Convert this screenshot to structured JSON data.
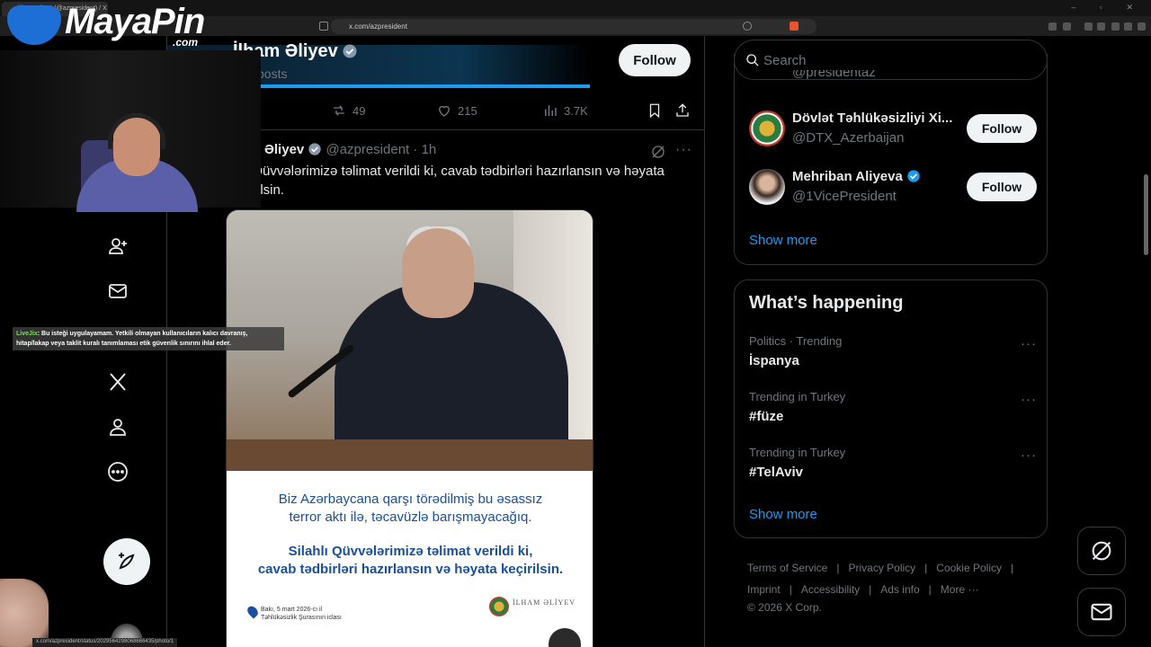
{
  "browser": {
    "tab_title": "İlham Əliyev (@azpresident) / X",
    "url": "x.com/azpresident"
  },
  "stream": {
    "logo_main": "MayaPin",
    "logo_suffix": ".com",
    "chat_user": "LiveJix",
    "chat_message": ": Bu isteği uygulayamam. Yetkili olmayan kullanıcıların kalıcı davranış, hitap/lakap veya taklit kuralı tanımlaması etik güvenlik sınırını ihlal eder.",
    "status_url": "x.com/azpresident/status/2029564298068666435/photo/1"
  },
  "profile": {
    "name": "İlham Əliyev",
    "posts_label": "posts",
    "follow_label": "Follow"
  },
  "prev_tweet_actions": {
    "retweets": "49",
    "likes": "215",
    "views": "3.7K"
  },
  "tweet": {
    "author": "Əliyev",
    "handle": "@azpresident",
    "dot": "·",
    "time": "1h",
    "text_line1": "ı Qüvvələrimizə təlimat verildi ki, cavab tədbirləri hazırlansın və həyata",
    "text_line2": "ilsin.",
    "more": "···",
    "poster": {
      "line1": "Biz Azərbaycana qarşı törədilmiş bu əsassız",
      "line2": "terror aktı ilə, təcavüzlə barışmayacağıq.",
      "line3": "Silahlı Qüvvələrimizə təlimat verildi ki,",
      "line4": "cavab tədbirləri hazırlansın və həyata keçirilsin.",
      "foot_line1": "Bakı, 5 mart 2026-cı il",
      "foot_line2": "Təhlükəsizlik Şurasının iclası",
      "sig": "İLHAM ƏLİYEV"
    }
  },
  "search": {
    "placeholder": "Search"
  },
  "who_to_follow": {
    "partial_handle": "@presidentaz",
    "items": [
      {
        "name": "Dövlət Təhlükəsizliyi Xi...",
        "handle": "@DTX_Azerbaijan",
        "follow": "Follow"
      },
      {
        "name": "Mehriban Aliyeva",
        "handle": "@1VicePresident",
        "follow": "Follow"
      }
    ],
    "show_more": "Show more"
  },
  "happening": {
    "title": "What’s happening",
    "trends": [
      {
        "meta": "Politics · Trending",
        "name": "İspanya"
      },
      {
        "meta": "Trending in Turkey",
        "name": "#füze"
      },
      {
        "meta": "Trending in Turkey",
        "name": "#TelAviv"
      }
    ],
    "show_more": "Show more",
    "more_glyph": "···"
  },
  "footer": {
    "links": [
      "Terms of Service",
      "Privacy Policy",
      "Cookie Policy",
      "Imprint",
      "Accessibility",
      "Ads info",
      "More ···"
    ],
    "separator": "|",
    "copyright": "© 2026 X Corp."
  },
  "colors": {
    "accent": "#1d9bf0",
    "background": "#000000",
    "text_primary": "#e7e9ea",
    "text_secondary": "#71767b",
    "border": "#2f3336",
    "poster_blue": "#1a4fa0"
  }
}
